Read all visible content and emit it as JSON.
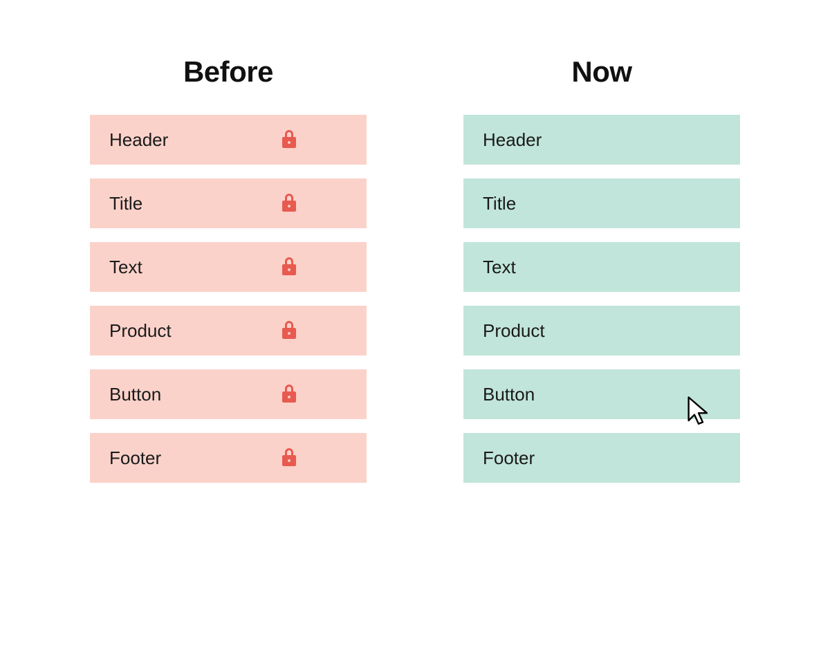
{
  "columns": {
    "before": {
      "title": "Before",
      "items": [
        {
          "label": "Header"
        },
        {
          "label": "Title"
        },
        {
          "label": "Text"
        },
        {
          "label": "Product"
        },
        {
          "label": "Button"
        },
        {
          "label": "Footer"
        }
      ]
    },
    "now": {
      "title": "Now",
      "items": [
        {
          "label": "Header"
        },
        {
          "label": "Title"
        },
        {
          "label": "Text"
        },
        {
          "label": "Product"
        },
        {
          "label": "Button",
          "cursor": true
        },
        {
          "label": "Footer"
        }
      ]
    }
  },
  "colors": {
    "before_bg": "#fbd2ca",
    "now_bg": "#c1e5da",
    "lock": "#e85a4f",
    "text": "#1a1a1a"
  }
}
